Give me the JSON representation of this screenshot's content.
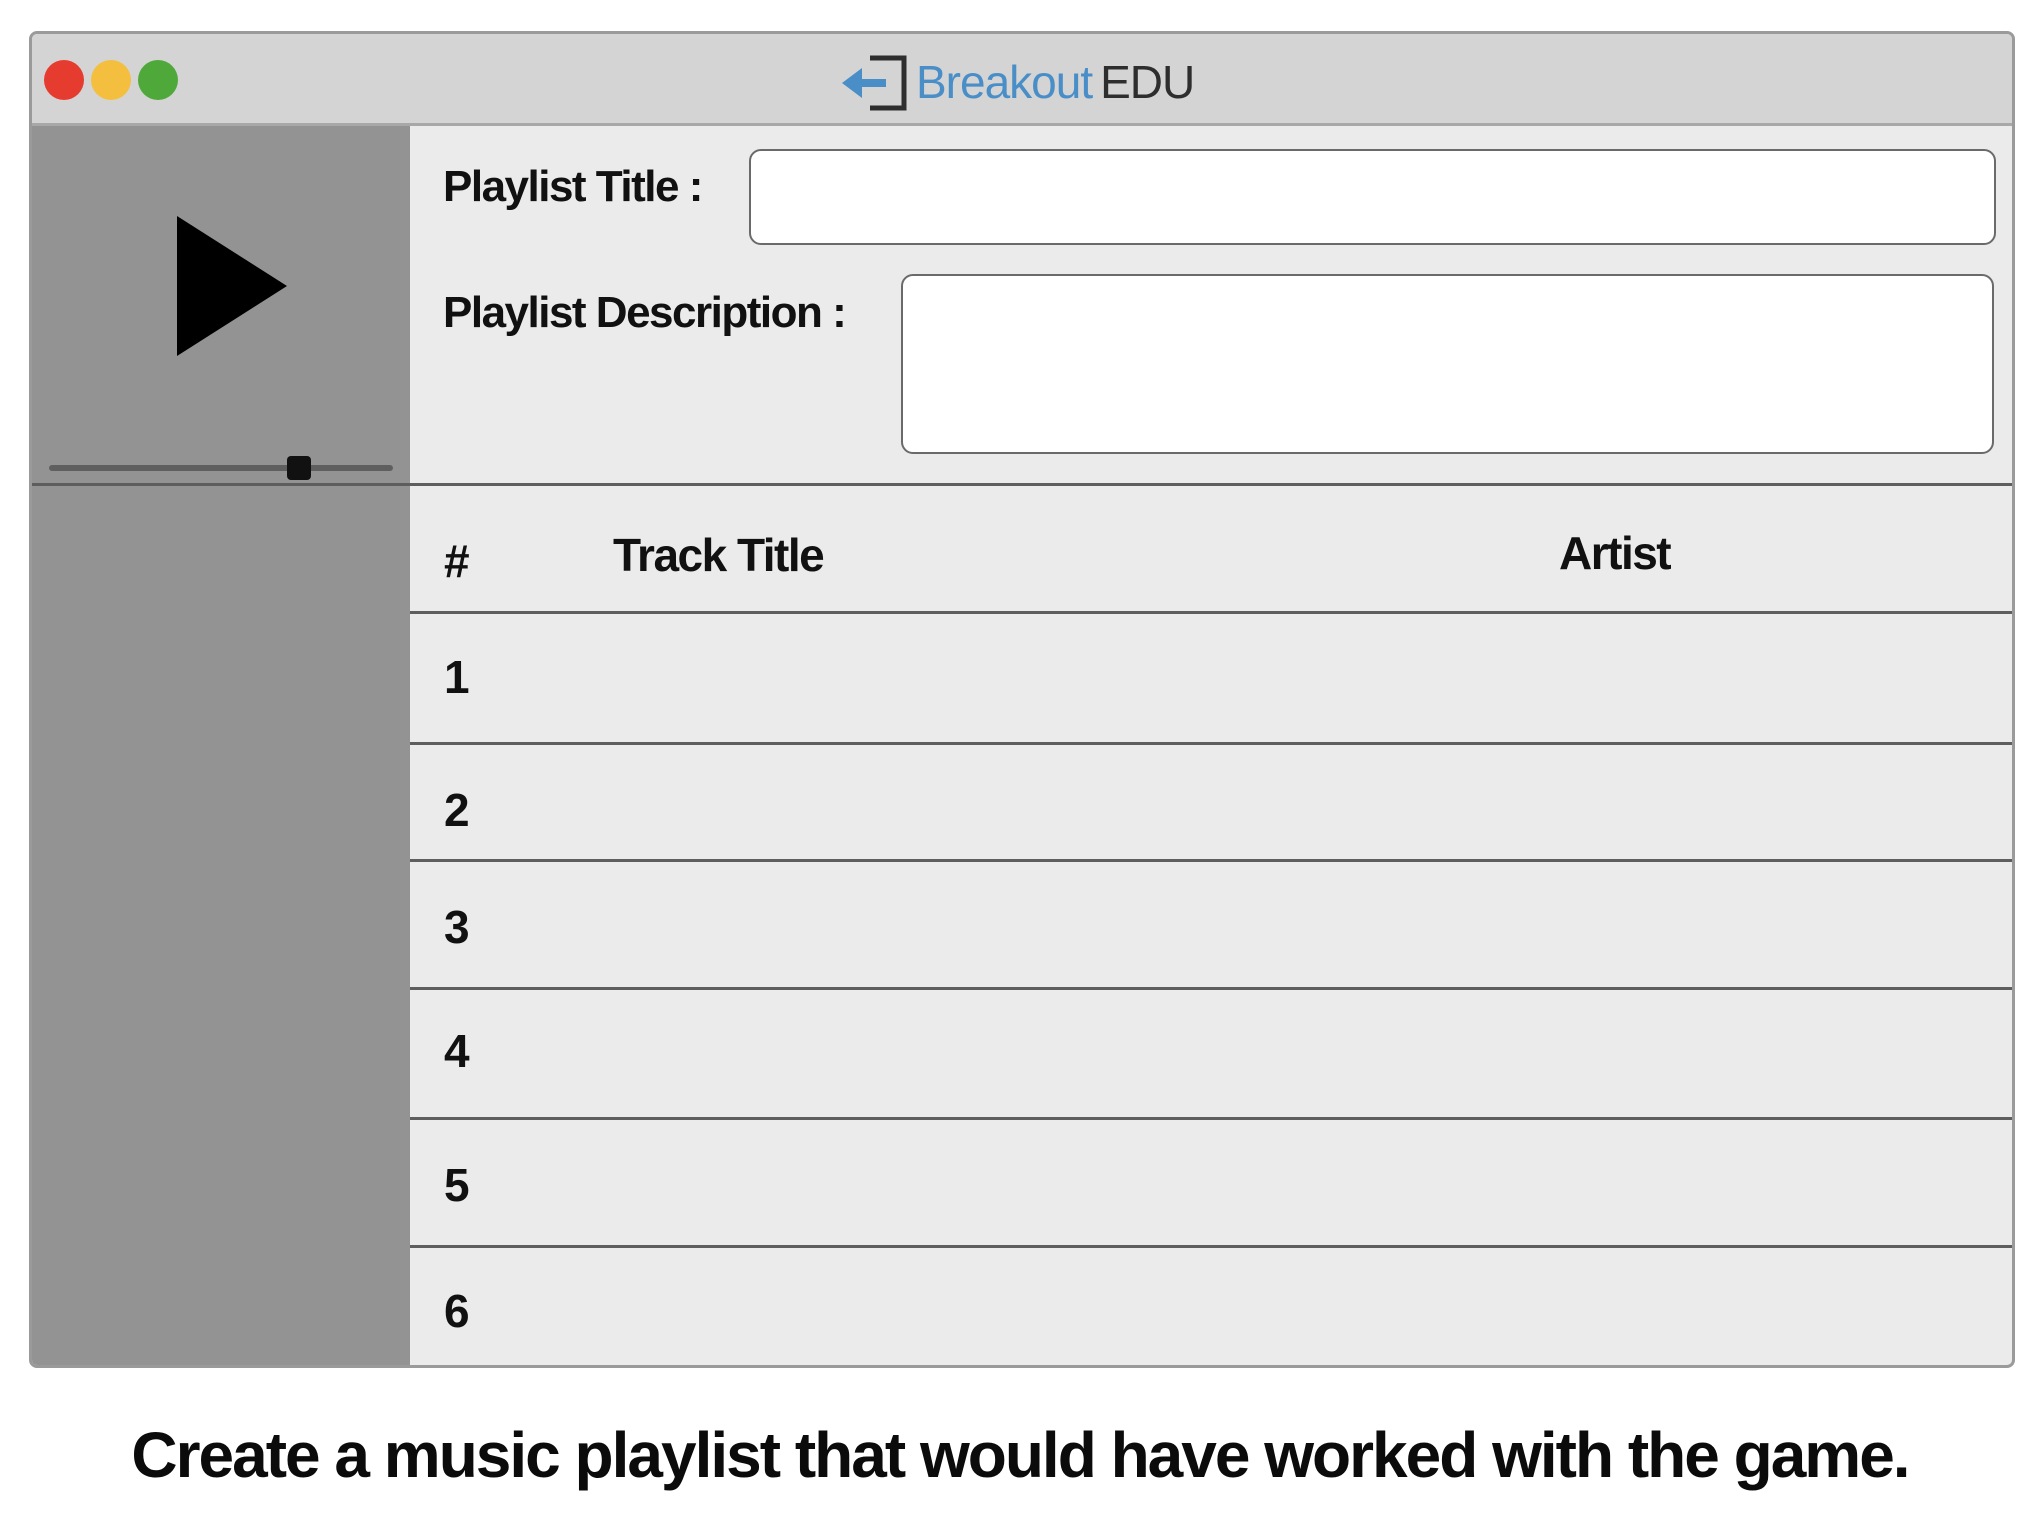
{
  "window": {
    "traffic_lights": [
      "close",
      "minimize",
      "zoom"
    ],
    "logo": {
      "word1": "Breakout",
      "word2": "EDU",
      "icon": "exit-door-arrow-icon",
      "accent": "#4a8ec8"
    }
  },
  "player": {
    "play_icon": "play-icon",
    "volume_level": 0.72
  },
  "form": {
    "title_label": "Playlist Title :",
    "title_value": "",
    "description_label": "Playlist Description :",
    "description_value": ""
  },
  "table": {
    "headers": {
      "number": "#",
      "track_title": "Track Title",
      "artist": "Artist"
    },
    "rows": [
      {
        "num": "1",
        "title": "",
        "artist": ""
      },
      {
        "num": "2",
        "title": "",
        "artist": ""
      },
      {
        "num": "3",
        "title": "",
        "artist": ""
      },
      {
        "num": "4",
        "title": "",
        "artist": ""
      },
      {
        "num": "5",
        "title": "",
        "artist": ""
      },
      {
        "num": "6",
        "title": "",
        "artist": ""
      }
    ]
  },
  "caption": "Create a music playlist that would have worked with the game."
}
